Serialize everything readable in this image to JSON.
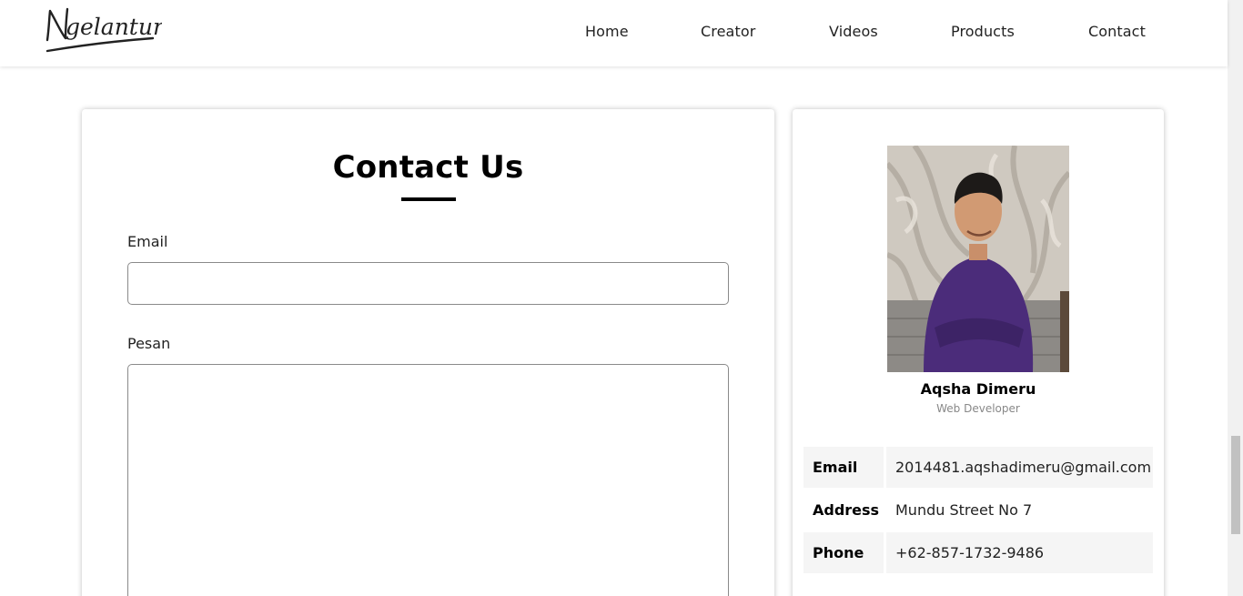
{
  "brand": {
    "logo_text": "Ngelantur!"
  },
  "nav": {
    "items": [
      {
        "label": "Home"
      },
      {
        "label": "Creator"
      },
      {
        "label": "Videos"
      },
      {
        "label": "Products"
      },
      {
        "label": "Contact"
      }
    ]
  },
  "contact_form": {
    "title": "Contact Us",
    "email_label": "Email",
    "email_value": "",
    "message_label": "Pesan",
    "message_value": ""
  },
  "profile": {
    "photo": "profile-photo",
    "name": "Aqsha Dimeru",
    "role": "Web Developer",
    "info": [
      {
        "key": "Email",
        "value": "2014481.aqshadimeru@gmail.com"
      },
      {
        "key": "Address",
        "value": "Mundu Street No 7"
      },
      {
        "key": "Phone",
        "value": "+62-857-1732-9486"
      }
    ]
  },
  "colors": {
    "accent": "#000000",
    "shade": "#f5f5f5",
    "shirt": "#4b2c7a"
  }
}
